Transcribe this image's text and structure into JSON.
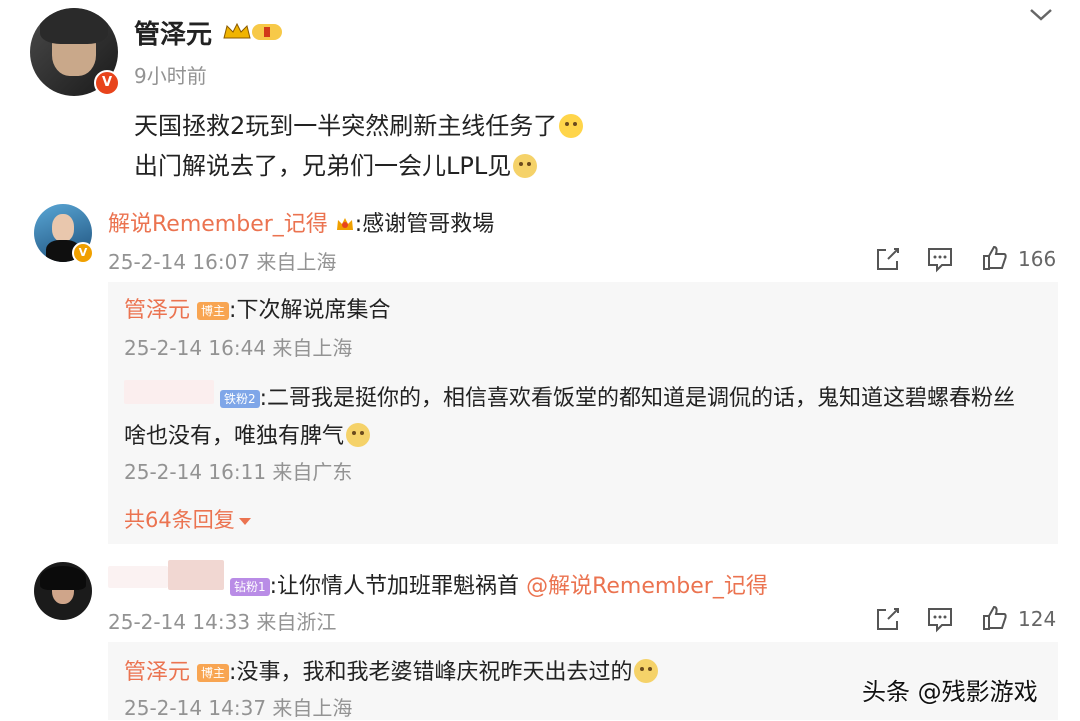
{
  "post": {
    "author": "管泽元",
    "time": "9小时前",
    "lines": [
      "天国拯救2玩到一半突然刷新主线任务了",
      "出门解说去了，兄弟们一会儿LPL见"
    ]
  },
  "comments": [
    {
      "author": "解说Remember_记得",
      "text": ":感谢管哥救場",
      "meta": "25-2-14 16:07 来自上海",
      "likes": "166",
      "replies": [
        {
          "author": "管泽元",
          "tag": "博主",
          "text": ":下次解说席集合",
          "meta": "25-2-14 16:44 来自上海"
        },
        {
          "author": "",
          "tag": "铁粉2",
          "text": ":二哥我是挺你的，相信喜欢看饭堂的都知道是调侃的话，鬼知道这碧螺春粉丝",
          "text2": "啥也没有，唯独有脾气",
          "meta": "25-2-14 16:11 来自广东"
        }
      ],
      "more_replies": "共64条回复"
    },
    {
      "author": "",
      "tag": "钻粉1",
      "text": ":让你情人节加班罪魁祸首",
      "mention": "@解说Remember_记得",
      "meta": "25-2-14 14:33 来自浙江",
      "likes": "124",
      "replies": [
        {
          "author": "管泽元",
          "tag": "博主",
          "text": ":没事，我和我老婆错峰庆祝昨天出去过的",
          "meta": "25-2-14 14:37 来自上海"
        }
      ]
    }
  ],
  "watermark": "头条 @残影游戏",
  "colors": {
    "accent": "#eb7350",
    "meta": "#939393",
    "reply_bg": "#f7f7f7"
  }
}
